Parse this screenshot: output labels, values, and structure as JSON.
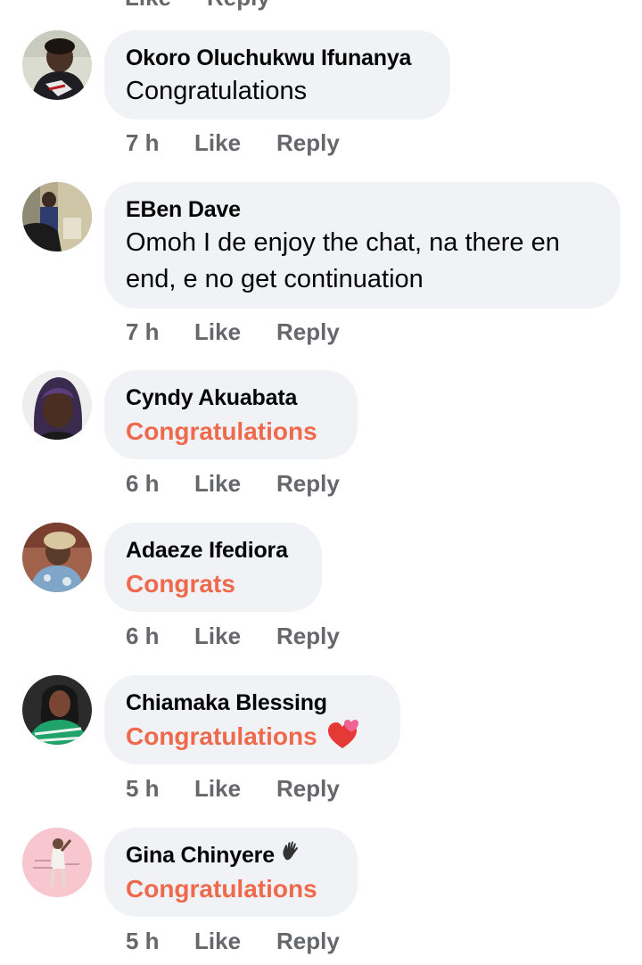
{
  "top": {
    "like_label": "Like",
    "reply_label": "Reply"
  },
  "comments": [
    {
      "author": "Okoro Oluchukwu Ifunanya",
      "text": "Congratulations",
      "time": "7 h",
      "like": "Like",
      "reply": "Reply"
    },
    {
      "author": "EBen Dave",
      "text_line1": "Omoh I de enjoy the chat, na there en",
      "text_line2": "end, e no get continuation",
      "time": "7 h",
      "like": "Like",
      "reply": "Reply"
    },
    {
      "author": "Cyndy Akuabata",
      "text": "Congratulations",
      "time": "6 h",
      "like": "Like",
      "reply": "Reply"
    },
    {
      "author": "Adaeze Ifediora",
      "text": "Congrats",
      "time": "6 h",
      "like": "Like",
      "reply": "Reply"
    },
    {
      "author": "Chiamaka Blessing",
      "text": "Congratulations",
      "emoji": "two-hearts-icon",
      "time": "5 h",
      "like": "Like",
      "reply": "Reply"
    },
    {
      "author": "Gina Chinyere",
      "author_badge": "waving-hand-icon",
      "text": "Congratulations",
      "time": "5 h",
      "like": "Like",
      "reply": "Reply"
    }
  ],
  "colors": {
    "bubble": "#f0f2f5",
    "meta_text": "#65676b",
    "highlight_text": "#ef6a4c"
  }
}
